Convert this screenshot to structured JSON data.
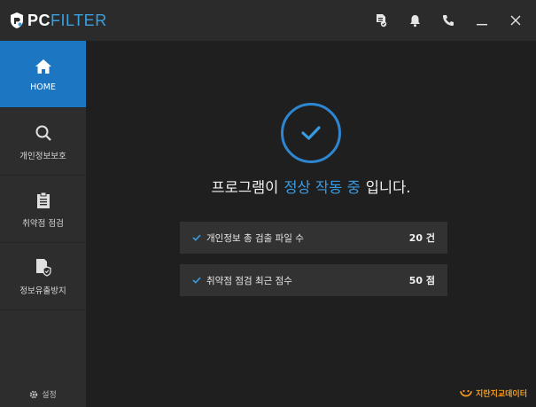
{
  "app": {
    "logo_pc": "PC",
    "logo_filter": "FILTER"
  },
  "titlebar_icons": [
    "report-icon",
    "bell-icon",
    "phone-icon",
    "minimize-icon",
    "close-icon"
  ],
  "sidebar": {
    "items": [
      {
        "label": "HOME",
        "icon": "home-icon",
        "active": true
      },
      {
        "label": "개인정보보호",
        "icon": "search-icon",
        "active": false
      },
      {
        "label": "취약점 점검",
        "icon": "clipboard-icon",
        "active": false
      },
      {
        "label": "정보유출방지",
        "icon": "document-shield-icon",
        "active": false
      }
    ],
    "settings_label": "설정"
  },
  "main": {
    "status_prefix": "프로그램이",
    "status_highlight": "정상 작동 중",
    "status_suffix": "입니다.",
    "stats": [
      {
        "label": "개인정보 총 검출 파일 수",
        "value": "20 건"
      },
      {
        "label": "취약점 점검 최근 점수",
        "value": "50 점"
      }
    ]
  },
  "brand": {
    "label": "지란지교데이터"
  },
  "colors": {
    "accent": "#1d76c2",
    "highlight": "#3a9ae0",
    "brand": "#f39a1e",
    "background": "#1f1f1f",
    "sidebar": "#2d2d2d"
  }
}
